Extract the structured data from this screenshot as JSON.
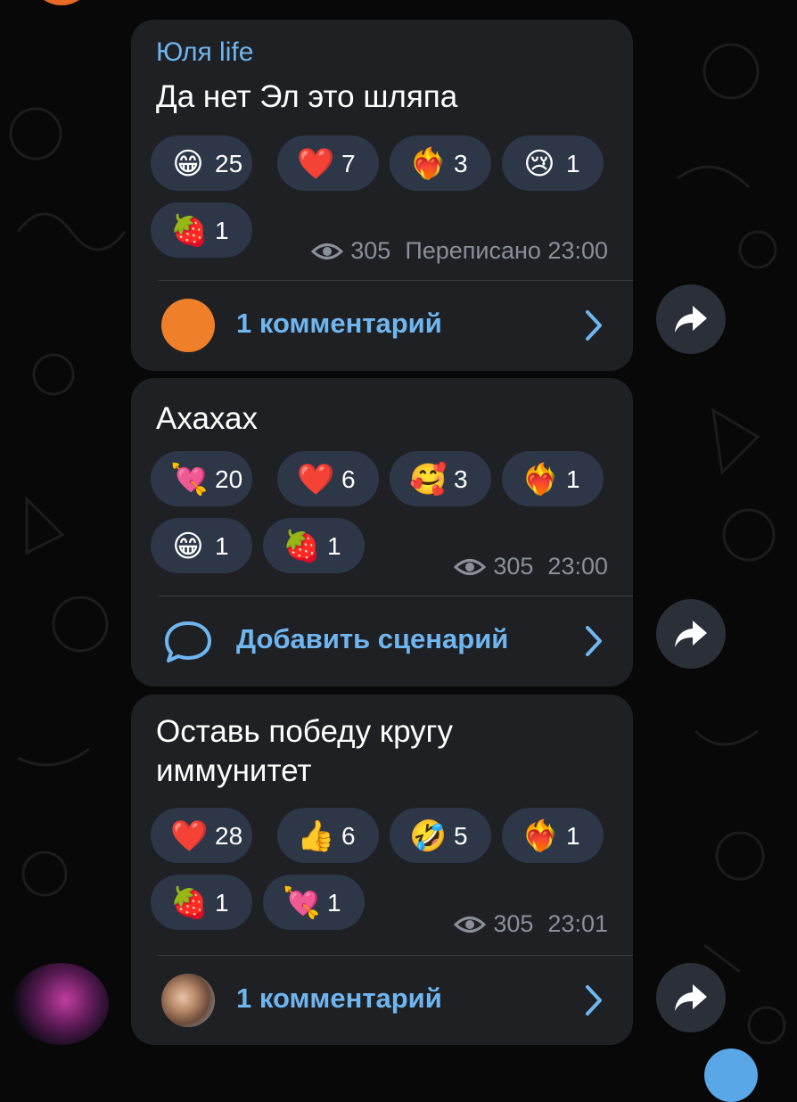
{
  "messages": [
    {
      "sender": "Юля life",
      "text_lines": [
        "Да нет Эл это шляпа"
      ],
      "reactions": [
        {
          "emoji": "😁",
          "count": "25"
        },
        {
          "emoji": "❤️",
          "count": "7"
        },
        {
          "emoji": "❤️‍🔥",
          "count": "3"
        },
        {
          "emoji": "😢",
          "count": "1"
        },
        {
          "emoji": "🍓",
          "count": "1"
        }
      ],
      "views": "305",
      "time_label": "Переписано 23:00",
      "footer_label": "1 комментарий",
      "footer_icon": "orange-avatar"
    },
    {
      "text_lines": [
        "Ахахах"
      ],
      "reactions": [
        {
          "emoji": "💘",
          "count": "20"
        },
        {
          "emoji": "❤️",
          "count": "6"
        },
        {
          "emoji": "🥰",
          "count": "3"
        },
        {
          "emoji": "❤️‍🔥",
          "count": "1"
        },
        {
          "emoji": "😁",
          "count": "1"
        },
        {
          "emoji": "🍓",
          "count": "1"
        }
      ],
      "views": "305",
      "time_label": "23:00",
      "footer_label": "Добавить сценарий",
      "footer_icon": "comment-bubble-icon"
    },
    {
      "text_lines": [
        "Оставь победу кругу",
        "иммунитет"
      ],
      "reactions": [
        {
          "emoji": "❤️",
          "count": "28"
        },
        {
          "emoji": "👍",
          "count": "6"
        },
        {
          "emoji": "🤣",
          "count": "5"
        },
        {
          "emoji": "❤️‍🔥",
          "count": "1"
        },
        {
          "emoji": "🍓",
          "count": "1"
        },
        {
          "emoji": "💘",
          "count": "1"
        }
      ],
      "views": "305",
      "time_label": "23:01",
      "footer_label": "1 комментарий",
      "footer_icon": "photo-avatar"
    }
  ],
  "colors": {
    "background": "#080808",
    "bubble": "#1f2024",
    "reaction_pill": "#2d3748",
    "accent_blue": "#6fb6f0",
    "meta_gray": "#8a8f98",
    "share_button": "#2b2f38"
  }
}
